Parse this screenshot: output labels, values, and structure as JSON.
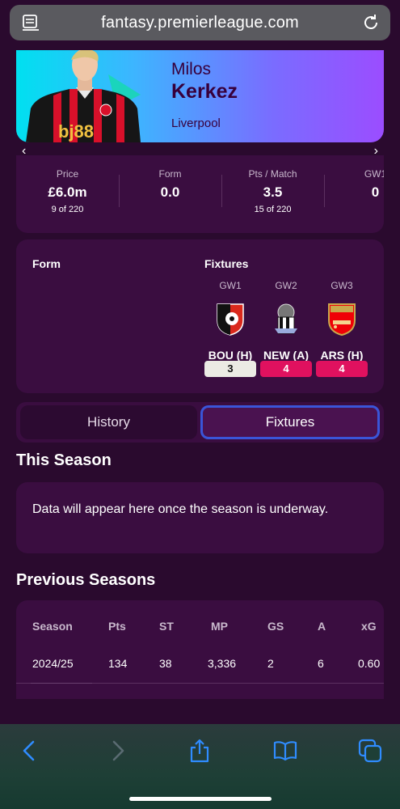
{
  "browser": {
    "url": "fantasy.premierleague.com",
    "reader_icon": "reader-icon",
    "reload_icon": "reload-icon"
  },
  "player": {
    "first_name": "Milos",
    "last_name": "Kerkez",
    "club": "Liverpool",
    "shirt_sponsor": "bj88"
  },
  "nav_arrows": {
    "left": "‹",
    "right": "›"
  },
  "stats": [
    {
      "label": "Price",
      "value": "£6.0m",
      "sub": "9 of 220"
    },
    {
      "label": "Form",
      "value": "0.0",
      "sub": ""
    },
    {
      "label": "Pts / Match",
      "value": "3.5",
      "sub": "15 of 220"
    },
    {
      "label": "GW1",
      "value": "0",
      "sub": ""
    }
  ],
  "form_fixtures": {
    "form_title": "Form",
    "fixtures_title": "Fixtures",
    "fixtures": [
      {
        "gw": "GW1",
        "team": "BOU (H)",
        "difficulty": "3",
        "badge": "bournemouth-badge-icon",
        "fdr_color": "#ebebe4"
      },
      {
        "gw": "GW2",
        "team": "NEW (A)",
        "difficulty": "4",
        "badge": "newcastle-badge-icon",
        "fdr_color": "#e0115f"
      },
      {
        "gw": "GW3",
        "team": "ARS (H)",
        "difficulty": "4",
        "badge": "arsenal-badge-icon",
        "fdr_color": "#e0115f"
      }
    ]
  },
  "tabs": {
    "history": "History",
    "fixtures": "Fixtures",
    "active": "Fixtures"
  },
  "this_season": {
    "title": "This Season",
    "message": "Data will appear here once the season is underway."
  },
  "previous_seasons": {
    "title": "Previous Seasons",
    "columns": [
      "Season",
      "Pts",
      "ST",
      "MP",
      "GS",
      "A",
      "xG"
    ],
    "rows": [
      [
        "2024/25",
        "134",
        "38",
        "3,336",
        "2",
        "6",
        "0.60"
      ]
    ]
  },
  "colors": {
    "background": "#2a0a2e",
    "card": "#3a0d40",
    "accent_blue": "#3a55d8",
    "fdr_easy": "#ebebe4",
    "fdr_hard": "#e0115f"
  },
  "toolbar": {
    "icons": [
      "back-icon",
      "forward-icon",
      "share-icon",
      "bookmarks-icon",
      "tabs-icon"
    ]
  }
}
